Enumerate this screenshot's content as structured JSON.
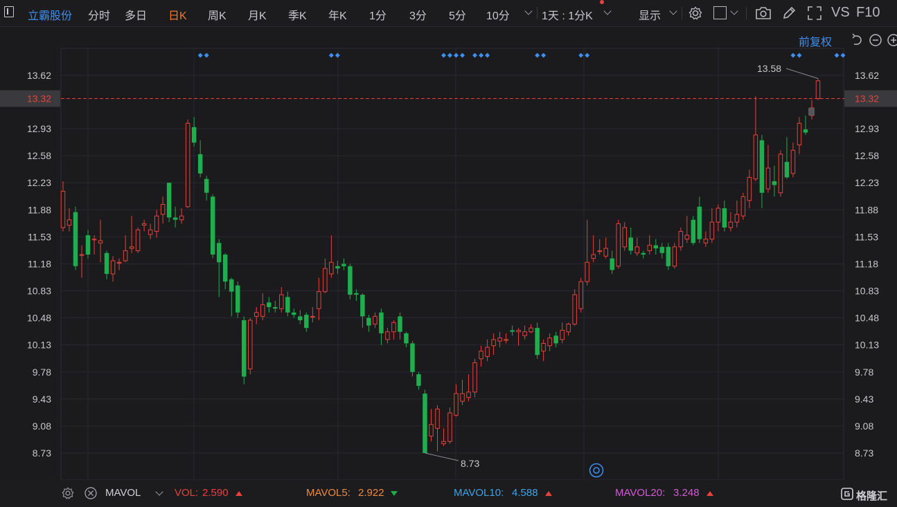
{
  "topbar": {
    "stock_name": "立霸股份",
    "tabs": [
      "分时",
      "多日",
      "日K",
      "周K",
      "月K",
      "季K",
      "年K",
      "1分",
      "3分",
      "5分",
      "10分"
    ],
    "active_tab": "日K",
    "period_selector": "1天 : 1分K",
    "display_label": "显示",
    "vs_label": "VS",
    "f10_label": "F10"
  },
  "chart_controls": {
    "adjust_label": "前复权"
  },
  "price_axis": {
    "ticks": [
      "13.62",
      "12.93",
      "12.58",
      "12.23",
      "11.88",
      "11.53",
      "11.18",
      "10.83",
      "10.48",
      "10.13",
      "9.78",
      "9.43",
      "9.08",
      "8.73"
    ],
    "current_price": "13.32"
  },
  "annotations": {
    "high_label": "13.58",
    "low_label": "8.73"
  },
  "bottom_bar": {
    "indicator_name": "MAVOL",
    "vol_label": "VOL:",
    "vol_value": "2.590",
    "mavol5_label": "MAVOL5:",
    "mavol5_value": "2.922",
    "mavol10_label": "MAVOL10:",
    "mavol10_value": "4.588",
    "mavol20_label": "MAVOL20:",
    "mavol20_value": "3.248",
    "brand": "格隆汇"
  },
  "colors": {
    "up": "#e8423c",
    "down": "#1fad4e",
    "accent_blue": "#3f8ff0",
    "active_orange": "#f07a2c",
    "mavol5": "#f08a3c",
    "mavol10": "#3fa3e8",
    "mavol20": "#d45ad8"
  },
  "chart_data": {
    "type": "candlestick",
    "y_axis": {
      "min": 8.73,
      "max": 13.62,
      "ticks": [
        13.62,
        12.93,
        12.58,
        12.23,
        11.88,
        11.53,
        11.18,
        10.83,
        10.48,
        10.13,
        9.78,
        9.43,
        9.08,
        8.73
      ]
    },
    "current_price": 13.32,
    "max_annotation": 13.58,
    "min_annotation": 8.73,
    "candles": [
      {
        "o": 11.65,
        "c": 12.12,
        "h": 12.25,
        "l": 11.6
      },
      {
        "o": 11.68,
        "c": 11.75,
        "h": 11.9,
        "l": 11.6
      },
      {
        "o": 11.85,
        "c": 11.15,
        "h": 11.92,
        "l": 11.1
      },
      {
        "o": 11.3,
        "c": 11.3,
        "h": 11.42,
        "l": 11.0
      },
      {
        "o": 11.55,
        "c": 11.3,
        "h": 11.62,
        "l": 11.25
      },
      {
        "o": 11.5,
        "c": 11.5,
        "h": 11.55,
        "l": 11.3
      },
      {
        "o": 11.45,
        "c": 11.48,
        "h": 11.75,
        "l": 11.2
      },
      {
        "o": 11.32,
        "c": 11.05,
        "h": 11.35,
        "l": 10.98
      },
      {
        "o": 11.05,
        "c": 11.22,
        "h": 11.28,
        "l": 10.95
      },
      {
        "o": 11.2,
        "c": 11.2,
        "h": 11.25,
        "l": 11.1
      },
      {
        "o": 11.22,
        "c": 11.35,
        "h": 11.55,
        "l": 11.2
      },
      {
        "o": 11.38,
        "c": 11.4,
        "h": 11.8,
        "l": 11.32
      },
      {
        "o": 11.35,
        "c": 11.62,
        "h": 11.65,
        "l": 11.32
      },
      {
        "o": 11.68,
        "c": 11.7,
        "h": 11.75,
        "l": 11.6
      },
      {
        "o": 11.56,
        "c": 11.62,
        "h": 11.7,
        "l": 11.5
      },
      {
        "o": 11.6,
        "c": 11.8,
        "h": 11.88,
        "l": 11.52
      },
      {
        "o": 11.82,
        "c": 11.95,
        "h": 12.05,
        "l": 11.7
      },
      {
        "o": 12.23,
        "c": 11.78,
        "h": 12.23,
        "l": 11.72
      },
      {
        "o": 11.78,
        "c": 11.75,
        "h": 11.92,
        "l": 11.65
      },
      {
        "o": 11.75,
        "c": 11.8,
        "h": 11.9,
        "l": 11.7
      },
      {
        "o": 11.92,
        "c": 13.0,
        "h": 13.05,
        "l": 11.9
      },
      {
        "o": 12.95,
        "c": 12.75,
        "h": 13.08,
        "l": 12.7
      },
      {
        "o": 12.6,
        "c": 12.35,
        "h": 12.78,
        "l": 12.3
      },
      {
        "o": 12.28,
        "c": 12.1,
        "h": 12.32,
        "l": 12.0
      },
      {
        "o": 12.05,
        "c": 11.3,
        "h": 12.08,
        "l": 11.25
      },
      {
        "o": 11.45,
        "c": 11.2,
        "h": 11.5,
        "l": 10.75
      },
      {
        "o": 11.3,
        "c": 10.95,
        "h": 11.32,
        "l": 10.85
      },
      {
        "o": 10.98,
        "c": 10.82,
        "h": 11.0,
        "l": 10.5
      },
      {
        "o": 10.9,
        "c": 10.55,
        "h": 10.95,
        "l": 10.48
      },
      {
        "o": 10.45,
        "c": 9.72,
        "h": 10.5,
        "l": 9.62
      },
      {
        "o": 9.82,
        "c": 10.45,
        "h": 10.48,
        "l": 9.75
      },
      {
        "o": 10.5,
        "c": 10.55,
        "h": 10.62,
        "l": 10.4
      },
      {
        "o": 10.5,
        "c": 10.65,
        "h": 10.8,
        "l": 10.45
      },
      {
        "o": 10.68,
        "c": 10.62,
        "h": 10.75,
        "l": 10.55
      },
      {
        "o": 10.62,
        "c": 10.6,
        "h": 10.7,
        "l": 10.55
      },
      {
        "o": 10.6,
        "c": 10.78,
        "h": 10.88,
        "l": 10.55
      },
      {
        "o": 10.75,
        "c": 10.55,
        "h": 10.82,
        "l": 10.5
      },
      {
        "o": 10.55,
        "c": 10.52,
        "h": 10.6,
        "l": 10.48
      },
      {
        "o": 10.5,
        "c": 10.45,
        "h": 10.58,
        "l": 10.4
      },
      {
        "o": 10.52,
        "c": 10.35,
        "h": 10.55,
        "l": 10.3
      },
      {
        "o": 10.5,
        "c": 10.5,
        "h": 10.62,
        "l": 10.42
      },
      {
        "o": 10.6,
        "c": 10.82,
        "h": 11.0,
        "l": 10.45
      },
      {
        "o": 10.82,
        "c": 11.12,
        "h": 11.25,
        "l": 10.8
      },
      {
        "o": 11.05,
        "c": 11.2,
        "h": 11.55,
        "l": 11.0
      },
      {
        "o": 11.15,
        "c": 11.12,
        "h": 11.22,
        "l": 11.05
      },
      {
        "o": 11.18,
        "c": 11.15,
        "h": 11.25,
        "l": 11.1
      },
      {
        "o": 11.15,
        "c": 10.78,
        "h": 11.18,
        "l": 10.72
      },
      {
        "o": 10.8,
        "c": 10.78,
        "h": 10.85,
        "l": 10.7
      },
      {
        "o": 10.78,
        "c": 10.5,
        "h": 10.8,
        "l": 10.35
      },
      {
        "o": 10.48,
        "c": 10.38,
        "h": 10.52,
        "l": 10.3
      },
      {
        "o": 10.4,
        "c": 10.5,
        "h": 10.55,
        "l": 10.35
      },
      {
        "o": 10.55,
        "c": 10.28,
        "h": 10.6,
        "l": 10.13
      },
      {
        "o": 10.2,
        "c": 10.3,
        "h": 10.35,
        "l": 10.15
      },
      {
        "o": 10.3,
        "c": 10.42,
        "h": 10.45,
        "l": 10.2
      },
      {
        "o": 10.5,
        "c": 10.3,
        "h": 10.55,
        "l": 10.2
      },
      {
        "o": 10.28,
        "c": 10.15,
        "h": 10.3,
        "l": 10.1
      },
      {
        "o": 10.15,
        "c": 9.78,
        "h": 10.18,
        "l": 9.72
      },
      {
        "o": 9.75,
        "c": 9.6,
        "h": 9.78,
        "l": 9.55
      },
      {
        "o": 9.5,
        "c": 8.73,
        "h": 9.55,
        "l": 8.73
      },
      {
        "o": 8.95,
        "c": 9.1,
        "h": 9.3,
        "l": 8.88
      },
      {
        "o": 9.05,
        "c": 9.3,
        "h": 9.35,
        "l": 8.75
      },
      {
        "o": 8.85,
        "c": 8.88,
        "h": 9.05,
        "l": 8.82
      },
      {
        "o": 8.88,
        "c": 9.25,
        "h": 9.32,
        "l": 8.85
      },
      {
        "o": 9.22,
        "c": 9.5,
        "h": 9.62,
        "l": 9.2
      },
      {
        "o": 9.4,
        "c": 9.5,
        "h": 9.68,
        "l": 9.35
      },
      {
        "o": 9.45,
        "c": 9.52,
        "h": 9.75,
        "l": 9.4
      },
      {
        "o": 9.52,
        "c": 9.9,
        "h": 9.95,
        "l": 9.45
      },
      {
        "o": 9.95,
        "c": 10.05,
        "h": 10.12,
        "l": 9.85
      },
      {
        "o": 9.98,
        "c": 10.1,
        "h": 10.2,
        "l": 9.92
      },
      {
        "o": 10.12,
        "c": 10.2,
        "h": 10.28,
        "l": 10.0
      },
      {
        "o": 10.18,
        "c": 10.22,
        "h": 10.3,
        "l": 10.1
      },
      {
        "o": 10.2,
        "c": 10.2,
        "h": 10.28,
        "l": 10.15
      },
      {
        "o": 10.32,
        "c": 10.3,
        "h": 10.38,
        "l": 10.25
      },
      {
        "o": 10.3,
        "c": 10.32,
        "h": 10.35,
        "l": 10.12
      },
      {
        "o": 10.25,
        "c": 10.3,
        "h": 10.38,
        "l": 10.2
      },
      {
        "o": 10.3,
        "c": 10.35,
        "h": 10.4,
        "l": 10.28
      },
      {
        "o": 10.35,
        "c": 10.0,
        "h": 10.42,
        "l": 9.95
      },
      {
        "o": 10.05,
        "c": 10.15,
        "h": 10.2,
        "l": 9.92
      },
      {
        "o": 10.12,
        "c": 10.22,
        "h": 10.28,
        "l": 10.05
      },
      {
        "o": 10.25,
        "c": 10.15,
        "h": 10.3,
        "l": 10.1
      },
      {
        "o": 10.2,
        "c": 10.32,
        "h": 10.42,
        "l": 10.15
      },
      {
        "o": 10.3,
        "c": 10.4,
        "h": 10.42,
        "l": 10.25
      },
      {
        "o": 10.4,
        "c": 10.78,
        "h": 10.85,
        "l": 10.38
      },
      {
        "o": 10.6,
        "c": 10.95,
        "h": 11.0,
        "l": 10.55
      },
      {
        "o": 10.95,
        "c": 11.2,
        "h": 11.75,
        "l": 10.9
      },
      {
        "o": 11.25,
        "c": 11.3,
        "h": 11.55,
        "l": 11.2
      },
      {
        "o": 11.35,
        "c": 11.35,
        "h": 11.5,
        "l": 11.3
      },
      {
        "o": 11.28,
        "c": 11.38,
        "h": 11.52,
        "l": 11.25
      },
      {
        "o": 11.25,
        "c": 11.1,
        "h": 11.35,
        "l": 11.05
      },
      {
        "o": 11.15,
        "c": 11.7,
        "h": 11.75,
        "l": 11.12
      },
      {
        "o": 11.4,
        "c": 11.65,
        "h": 11.72,
        "l": 11.35
      },
      {
        "o": 11.52,
        "c": 11.35,
        "h": 11.65,
        "l": 11.3
      },
      {
        "o": 11.32,
        "c": 11.4,
        "h": 11.52,
        "l": 11.28
      },
      {
        "o": 11.32,
        "c": 11.3,
        "h": 11.35,
        "l": 11.25
      },
      {
        "o": 11.35,
        "c": 11.42,
        "h": 11.55,
        "l": 11.3
      },
      {
        "o": 11.42,
        "c": 11.38,
        "h": 11.5,
        "l": 11.3
      },
      {
        "o": 11.4,
        "c": 11.32,
        "h": 11.45,
        "l": 11.25
      },
      {
        "o": 11.4,
        "c": 11.15,
        "h": 11.45,
        "l": 11.1
      },
      {
        "o": 11.15,
        "c": 11.4,
        "h": 11.45,
        "l": 11.12
      },
      {
        "o": 11.4,
        "c": 11.6,
        "h": 11.65,
        "l": 11.35
      },
      {
        "o": 11.5,
        "c": 11.55,
        "h": 11.8,
        "l": 11.45
      },
      {
        "o": 11.75,
        "c": 11.45,
        "h": 11.8,
        "l": 11.42
      },
      {
        "o": 11.92,
        "c": 11.5,
        "h": 12.05,
        "l": 11.45
      },
      {
        "o": 11.45,
        "c": 11.5,
        "h": 11.6,
        "l": 11.4
      },
      {
        "o": 11.5,
        "c": 11.72,
        "h": 11.9,
        "l": 11.45
      },
      {
        "o": 11.72,
        "c": 11.9,
        "h": 11.95,
        "l": 11.6
      },
      {
        "o": 11.9,
        "c": 11.65,
        "h": 12.0,
        "l": 11.6
      },
      {
        "o": 11.65,
        "c": 11.72,
        "h": 11.85,
        "l": 11.6
      },
      {
        "o": 11.72,
        "c": 11.82,
        "h": 12.0,
        "l": 11.65
      },
      {
        "o": 11.8,
        "c": 12.05,
        "h": 12.1,
        "l": 11.75
      },
      {
        "o": 12.0,
        "c": 12.3,
        "h": 12.4,
        "l": 11.9
      },
      {
        "o": 12.28,
        "c": 12.85,
        "h": 13.35,
        "l": 12.25
      },
      {
        "o": 12.78,
        "c": 12.1,
        "h": 12.85,
        "l": 11.9
      },
      {
        "o": 12.15,
        "c": 12.42,
        "h": 12.72,
        "l": 12.1
      },
      {
        "o": 12.25,
        "c": 12.2,
        "h": 12.45,
        "l": 12.05
      },
      {
        "o": 12.1,
        "c": 12.6,
        "h": 12.65,
        "l": 12.05
      },
      {
        "o": 12.5,
        "c": 12.3,
        "h": 12.82,
        "l": 12.28
      },
      {
        "o": 12.35,
        "c": 12.65,
        "h": 12.75,
        "l": 12.3
      },
      {
        "o": 12.72,
        "c": 13.0,
        "h": 13.08,
        "l": 12.6
      },
      {
        "o": 12.92,
        "c": 12.88,
        "h": 13.1,
        "l": 12.85
      },
      {
        "o": 13.1,
        "c": 13.2,
        "h": 13.3,
        "l": 13.05
      },
      {
        "o": 13.32,
        "c": 13.55,
        "h": 13.58,
        "l": 13.3
      }
    ],
    "markers": [
      22,
      23,
      43,
      44,
      61,
      62,
      63,
      64,
      66,
      67,
      68,
      76,
      77,
      83,
      84,
      117,
      118,
      124,
      125
    ]
  }
}
